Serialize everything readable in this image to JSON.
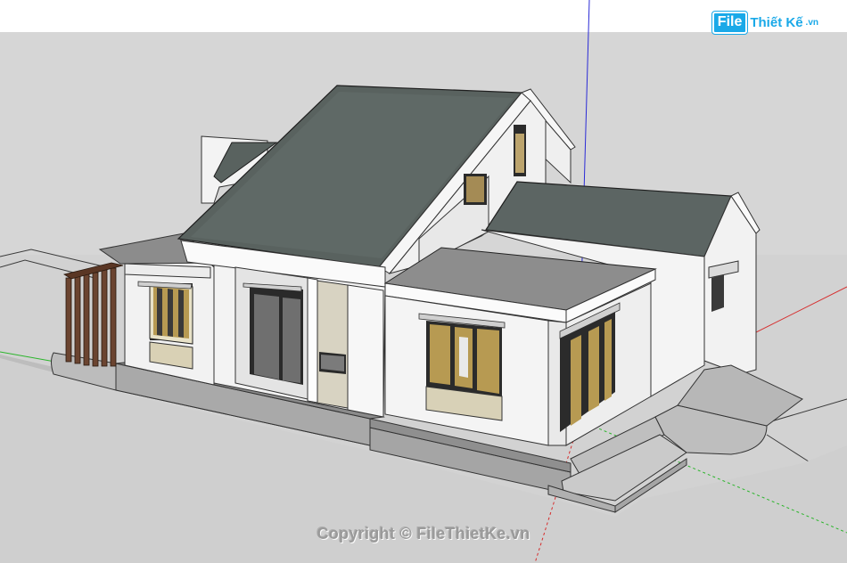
{
  "app": {
    "name": "SketchUp model viewport"
  },
  "logo": {
    "badge": "File",
    "name": "Thiết Kế",
    "tld": ".vn"
  },
  "watermark": {
    "text": "Copyright © FileThietKe.vn"
  },
  "scene": {
    "model": "single-storey house with gable roofs",
    "axes": {
      "blue": "#2b2bd6",
      "red": "#d62b2b",
      "green": "#2bb52b"
    },
    "colors": {
      "sky": "#ffffff",
      "ground": "#d2d2d2",
      "roof": "#5b6466",
      "wall": "#f4f4f4",
      "slab": "#8c8c8c",
      "trim": "#5a3b2a"
    }
  }
}
